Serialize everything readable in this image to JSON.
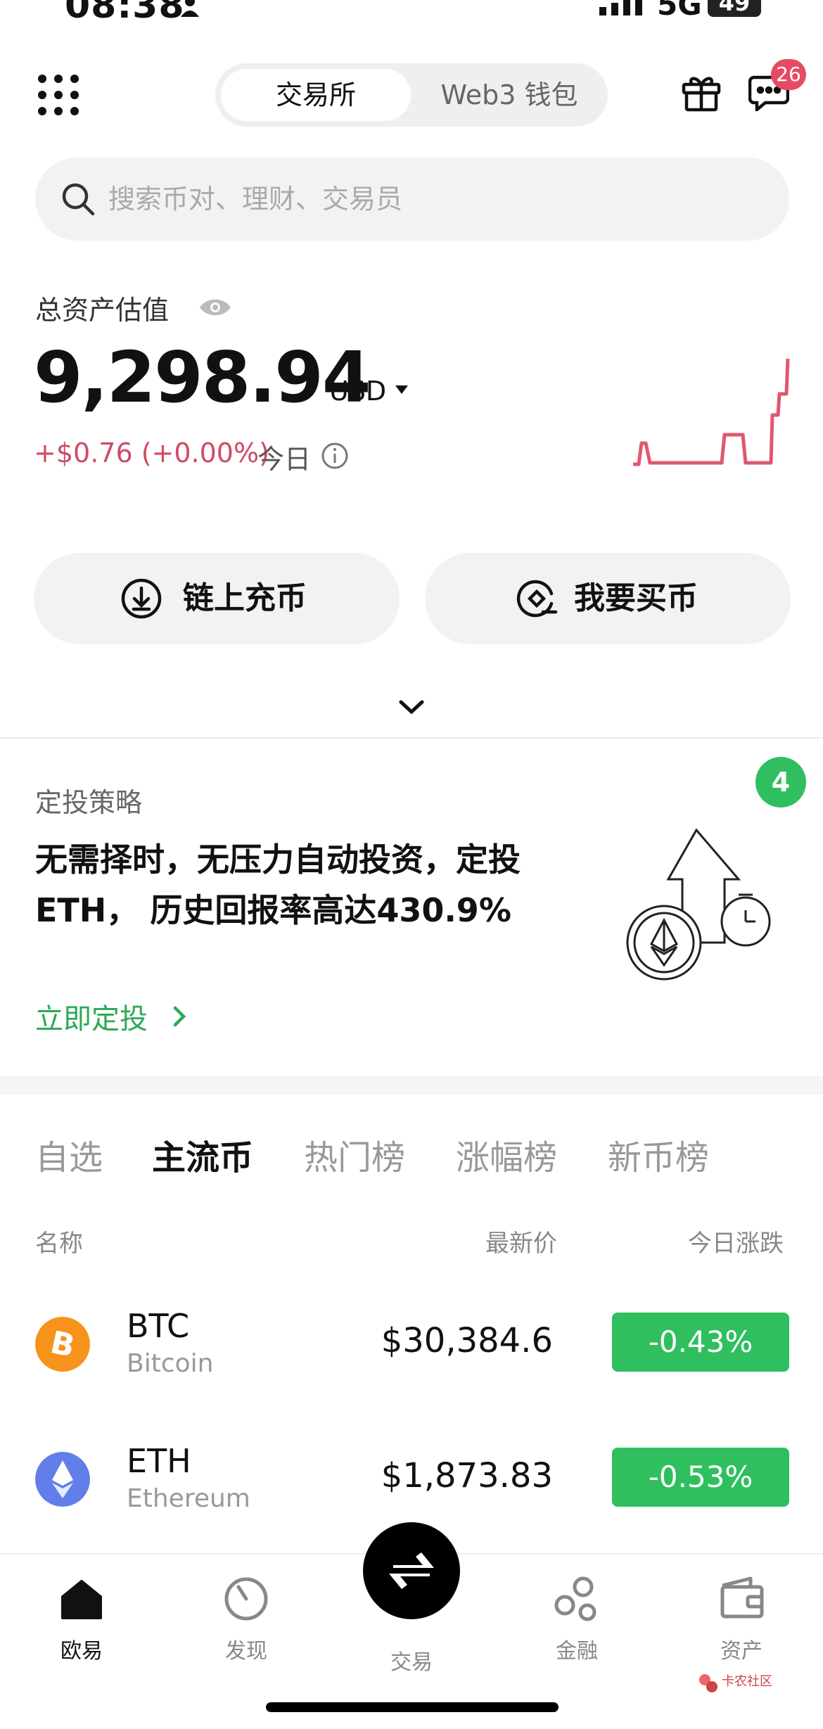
{
  "status_bar": {
    "time": "08:38",
    "network": "5G",
    "battery": "49"
  },
  "header": {
    "segment": {
      "active": "交易所",
      "inactive": "Web3 钱包"
    },
    "message_badge": "26"
  },
  "search": {
    "placeholder": "搜索币对、理财、交易员"
  },
  "assets": {
    "label": "总资产估值",
    "value": "9,298.94",
    "unit": "USD",
    "change": "+$0.76 (+0.00%)",
    "period": "今日"
  },
  "actions": {
    "deposit_label": "链上充币",
    "buy_label": "我要买币"
  },
  "banner": {
    "title": "定投策略",
    "count": "4",
    "text": "无需择时，无压力自动投资，定投 ETH， 历史回报率高达430.9%",
    "link": "立即定投"
  },
  "market": {
    "tabs": [
      "自选",
      "主流币",
      "热门榜",
      "涨幅榜",
      "新币榜"
    ],
    "active_tab": 1,
    "columns": {
      "name": "名称",
      "price": "最新价",
      "change": "今日涨跌"
    },
    "rows": [
      {
        "symbol": "BTC",
        "name": "Bitcoin",
        "price": "$30,384.6",
        "change": "-0.43%",
        "icon": "bitcoin-icon",
        "icon_color": "#f7931a"
      },
      {
        "symbol": "ETH",
        "name": "Ethereum",
        "price": "$1,873.83",
        "change": "-0.53%",
        "icon": "ethereum-icon",
        "icon_color": "#627eea"
      }
    ]
  },
  "colors": {
    "accent_green": "#2fbf5e",
    "negative_red": "#d04a64",
    "badge_red": "#e64b63"
  },
  "bottom_nav": [
    {
      "label": "欧易",
      "icon": "home-icon",
      "active": true
    },
    {
      "label": "发现",
      "icon": "discover-icon",
      "active": false
    },
    {
      "label": "交易",
      "icon": "trade-icon",
      "active": false
    },
    {
      "label": "金融",
      "icon": "finance-icon",
      "active": false
    },
    {
      "label": "资产",
      "icon": "wallet-icon",
      "active": false
    }
  ],
  "watermark": "卡农社区"
}
